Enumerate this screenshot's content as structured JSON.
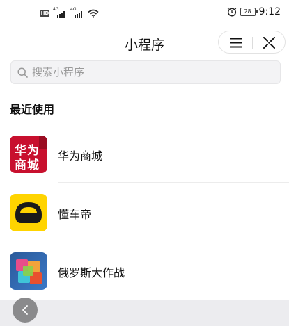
{
  "status_bar": {
    "time": "9:12",
    "battery": "28",
    "hd_badge": "HD",
    "signal_1_label": "4G",
    "signal_2_label": "4G",
    "icons": [
      "hd-icon",
      "signal-icon",
      "signal-icon",
      "wifi-icon",
      "alarm-icon",
      "battery-icon"
    ]
  },
  "nav": {
    "title": "小程序",
    "menu_icon": "menu-icon",
    "close_icon": "close-icon"
  },
  "search": {
    "placeholder": "搜索小程序",
    "value": ""
  },
  "recent": {
    "title": "最近使用",
    "items": [
      {
        "name": "华为商城",
        "icon": "huawei-mall-icon",
        "icon_text_1": "华为",
        "icon_text_2": "商城",
        "color": "#c8102e"
      },
      {
        "name": "懂车帝",
        "icon": "dongchedi-icon",
        "color": "#ffd400"
      },
      {
        "name": "俄罗斯大作战",
        "icon": "puzzle-game-icon",
        "color": "#2b5a9a"
      }
    ]
  },
  "bottom": {
    "back_icon": "chevron-left-icon"
  }
}
